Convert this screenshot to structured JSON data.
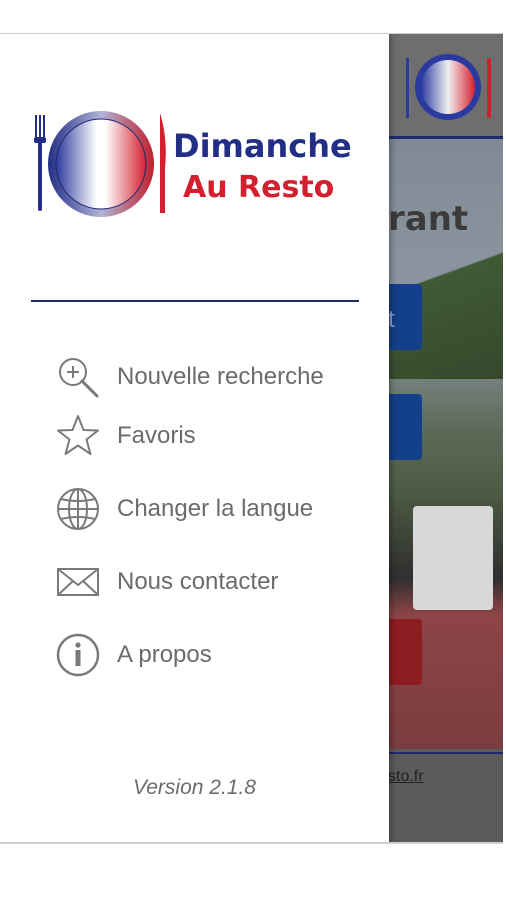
{
  "app": {
    "brand_line1": "Dimanche",
    "brand_line2": "Au Resto",
    "logo_plate_text_top": "Dimanche",
    "logo_plate_text_bottom": "Au Resto"
  },
  "drawer": {
    "menu": [
      {
        "label": "Nouvelle recherche",
        "icon": "search-plus-icon"
      },
      {
        "label": "Favoris",
        "icon": "star-icon"
      },
      {
        "label": "Changer la langue",
        "icon": "globe-icon"
      },
      {
        "label": "Nous contacter",
        "icon": "envelope-icon"
      },
      {
        "label": "A propos",
        "icon": "info-icon"
      }
    ],
    "version": "Version 2.1.8"
  },
  "background": {
    "heading_fragment": "rant",
    "button_fragment": "t",
    "footer_link_fragment": "sto.fr"
  },
  "colors": {
    "brand_blue": "#232f86",
    "brand_red": "#d3202f",
    "menu_text": "#6b6b6b",
    "divider": "#1e2a6e"
  }
}
